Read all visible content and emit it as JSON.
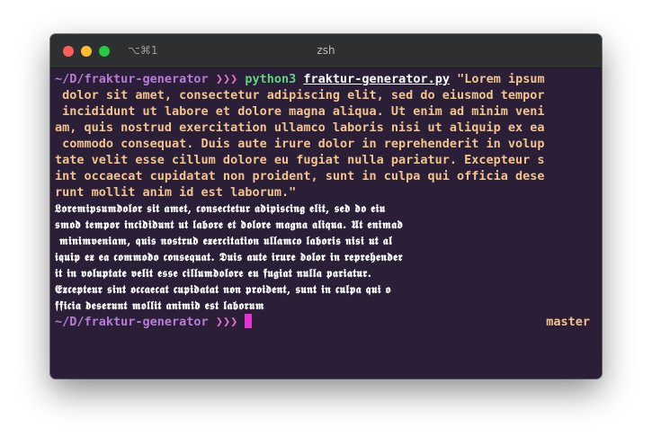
{
  "window": {
    "shortcut": "⌥⌘1",
    "title": "zsh"
  },
  "prompt": {
    "path": "~/D/fraktur-generator",
    "arrows": "❯❯❯",
    "branch": "master"
  },
  "command": {
    "program": "python3",
    "script": "fraktur-generator.py",
    "argument_lines": [
      "\"Lorem ipsum",
      " dolor sit amet, consectetur adipiscing elit, sed do eiusmod tempor",
      " incididunt ut labore et dolore magna aliqua. Ut enim ad minim veni",
      "am, quis nostrud exercitation ullamco laboris nisi ut aliquip ex ea",
      " commodo consequat. Duis aute irure dolor in reprehenderit in volup",
      "tate velit esse cillum dolore eu fugiat nulla pariatur. Excepteur s",
      "int occaecat cupidatat non proident, sunt in culpa qui officia dese",
      "runt mollit anim id est laborum.\""
    ]
  },
  "output": {
    "lines": [
      "𝕷𝖔𝖗𝖊𝖒𝖎𝖕𝖘𝖚𝖒𝖉𝖔𝖑𝖔𝖗 𝖘𝖎𝖙 𝖆𝖒𝖊𝖙, 𝖈𝖔𝖓𝖘𝖊𝖈𝖙𝖊𝖙𝖚𝖗 𝖆𝖉𝖎𝖕𝖎𝖘𝖈𝖎𝖓𝖌 𝖊𝖑𝖎𝖙, 𝖘𝖊𝖉 𝖉𝖔 𝖊𝖎𝖚",
      "𝖘𝖒𝖔𝖉 𝖙𝖊𝖒𝖕𝖔𝖗 𝖎𝖓𝖈𝖎𝖉𝖎𝖉𝖚𝖓𝖙 𝖚𝖙 𝖑𝖆𝖇𝖔𝖗𝖊 𝖊𝖙 𝖉𝖔𝖑𝖔𝖗𝖊 𝖒𝖆𝖌𝖓𝖆 𝖆𝖑𝖎𝖖𝖚𝖆. 𝖀𝖙 𝖊𝖓𝖎𝖒𝖆𝖉",
      " 𝖒𝖎𝖓𝖎𝖒𝖛𝖊𝖓𝖎𝖆𝖒, 𝖖𝖚𝖎𝖘 𝖓𝖔𝖘𝖙𝖗𝖚𝖉 𝖊𝖝𝖊𝖗𝖈𝖎𝖙𝖆𝖙𝖎𝖔𝖓 𝖚𝖑𝖑𝖆𝖒𝖈𝖔 𝖑𝖆𝖇𝖔𝖗𝖎𝖘 𝖓𝖎𝖘𝖎 𝖚𝖙 𝖆𝖑",
      "𝖎𝖖𝖚𝖎𝖕 𝖊𝖝 𝖊𝖆 𝖈𝖔𝖒𝖒𝖔𝖉𝖔 𝖈𝖔𝖓𝖘𝖊𝖖𝖚𝖆𝖙. 𝕯𝖚𝖎𝖘 𝖆𝖚𝖙𝖊 𝖎𝖗𝖚𝖗𝖊 𝖉𝖔𝖑𝖔𝖗 𝖎𝖓 𝖗𝖊𝖕𝖗𝖊𝖍𝖊𝖓𝖉𝖊𝖗",
      "𝖎𝖙 𝖎𝖓 𝖛𝖔𝖑𝖚𝖕𝖙𝖆𝖙𝖊 𝖛𝖊𝖑𝖎𝖙 𝖊𝖘𝖘𝖊 𝖈𝖎𝖑𝖑𝖚𝖒𝖉𝖔𝖑𝖔𝖗𝖊 𝖊𝖚 𝖋𝖚𝖌𝖎𝖆𝖙 𝖓𝖚𝖑𝖑𝖆 𝖕𝖆𝖗𝖎𝖆𝖙𝖚𝖗.",
      "𝕰𝖝𝖈𝖊𝖕𝖙𝖊𝖚𝖗 𝖘𝖎𝖓𝖙 𝖔𝖈𝖈𝖆𝖊𝖈𝖆𝖙 𝖈𝖚𝖕𝖎𝖉𝖆𝖙𝖆𝖙 𝖓𝖔𝖓 𝖕𝖗𝖔𝖎𝖉𝖊𝖓𝖙, 𝖘𝖚𝖓𝖙 𝖎𝖓 𝖈𝖚𝖑𝖕𝖆 𝖖𝖚𝖎 𝖔",
      "𝖋𝖋𝖎𝖈𝖎𝖆 𝖉𝖊𝖘𝖊𝖗𝖚𝖓𝖙 𝖒𝖔𝖑𝖑𝖎𝖙 𝖆𝖓𝖎𝖒𝖎𝖉 𝖊𝖘𝖙 𝖑𝖆𝖇𝖔𝖗𝖚𝖒"
    ]
  },
  "colors": {
    "background": "#2b1f38",
    "path": "#b77bd6",
    "arrows": "#e46fcf",
    "command": "#5fd27f",
    "argument": "#f2c38b",
    "cursor": "#e533d4"
  }
}
